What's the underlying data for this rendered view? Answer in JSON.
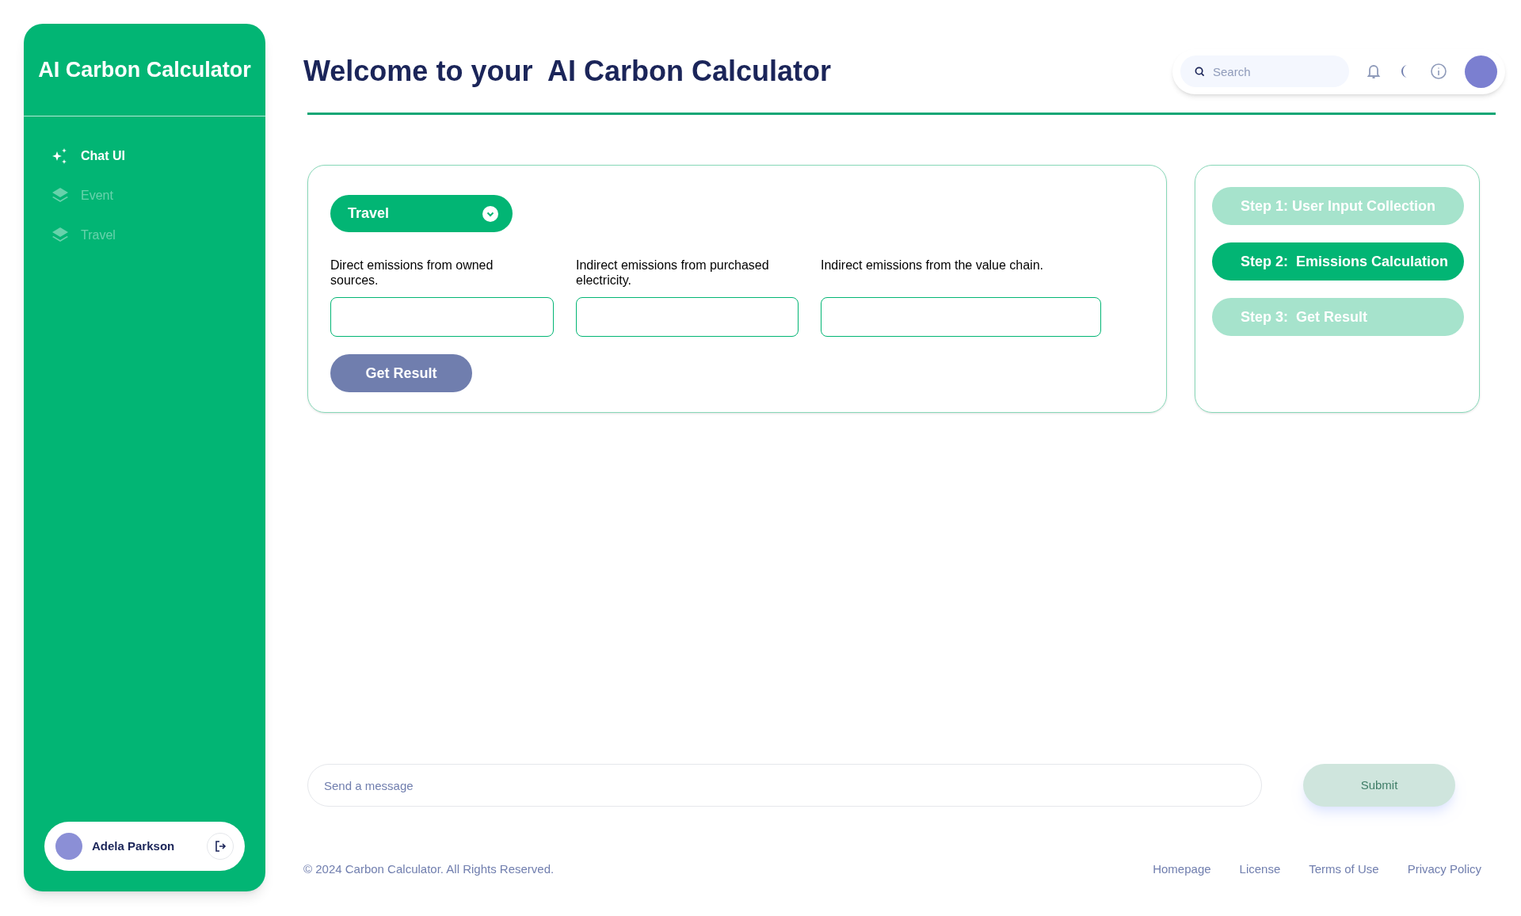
{
  "sidebar": {
    "title": "AI Carbon Calculator",
    "items": [
      {
        "label": "Chat UI",
        "kind": "chat",
        "selected": true
      },
      {
        "label": "Event",
        "kind": "category",
        "selected": false
      },
      {
        "label": "Travel",
        "kind": "category",
        "selected": false
      }
    ],
    "user": {
      "name": "Adela Parkson"
    }
  },
  "header": {
    "title": "Welcome to your  AI Carbon Calculator",
    "search": {
      "placeholder": "Search"
    }
  },
  "form": {
    "dropdown": {
      "value": "Travel"
    },
    "fields": [
      {
        "label": "Direct emissions from owned sources."
      },
      {
        "label": "Indirect emissions from purchased electricity."
      },
      {
        "label": "Indirect emissions from the value chain."
      }
    ],
    "button": {
      "label": "Get Result",
      "disabled": true
    }
  },
  "steps": [
    {
      "label": "Step 1: User Input Collection",
      "selected": false
    },
    {
      "label": "Step 2:  Emissions Calculation",
      "selected": true
    },
    {
      "label": "Step 3:  Get Result",
      "selected": false
    }
  ],
  "chat": {
    "placeholder": "Send a message",
    "submit": {
      "label": "Submit",
      "disabled": true
    }
  },
  "footer": {
    "copyright": "© 2024 Carbon Calculator. All Rights Reserved.",
    "links": [
      "Homepage",
      "License",
      "Terms of Use",
      "Privacy Policy"
    ]
  }
}
